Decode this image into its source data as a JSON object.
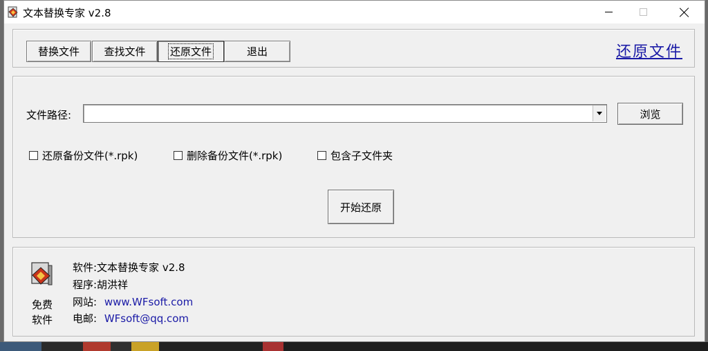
{
  "window": {
    "title": "文本替换专家 v2.8"
  },
  "tabs": [
    {
      "label": "替换文件",
      "active": false
    },
    {
      "label": "查找文件",
      "active": false
    },
    {
      "label": "还原文件",
      "active": true
    },
    {
      "label": "退出",
      "active": false
    }
  ],
  "heading": "还原文件",
  "form": {
    "path_label": "文件路径:",
    "path_value": "",
    "browse_label": "浏览",
    "checkboxes": [
      {
        "label": "还原备份文件(*.rpk)",
        "checked": false
      },
      {
        "label": "删除备份文件(*.rpk)",
        "checked": false
      },
      {
        "label": "包含子文件夹",
        "checked": false
      }
    ],
    "start_label": "开始还原"
  },
  "info": {
    "free_line1": "免费",
    "free_line2": "软件",
    "software": "软件:文本替换专家 v2.8",
    "author": "程序:胡洪祥",
    "website_label": "网站:",
    "website": "www.WFsoft.com",
    "email_label": "电邮:",
    "email": "WFsoft@qq.com"
  },
  "colors": {
    "link": "#1a1aa6",
    "window_bg": "#f0f0f0"
  },
  "icons": [
    "app-icon",
    "minimize-icon",
    "maximize-icon",
    "close-icon",
    "dropdown-arrow-icon",
    "free-software-icon"
  ]
}
